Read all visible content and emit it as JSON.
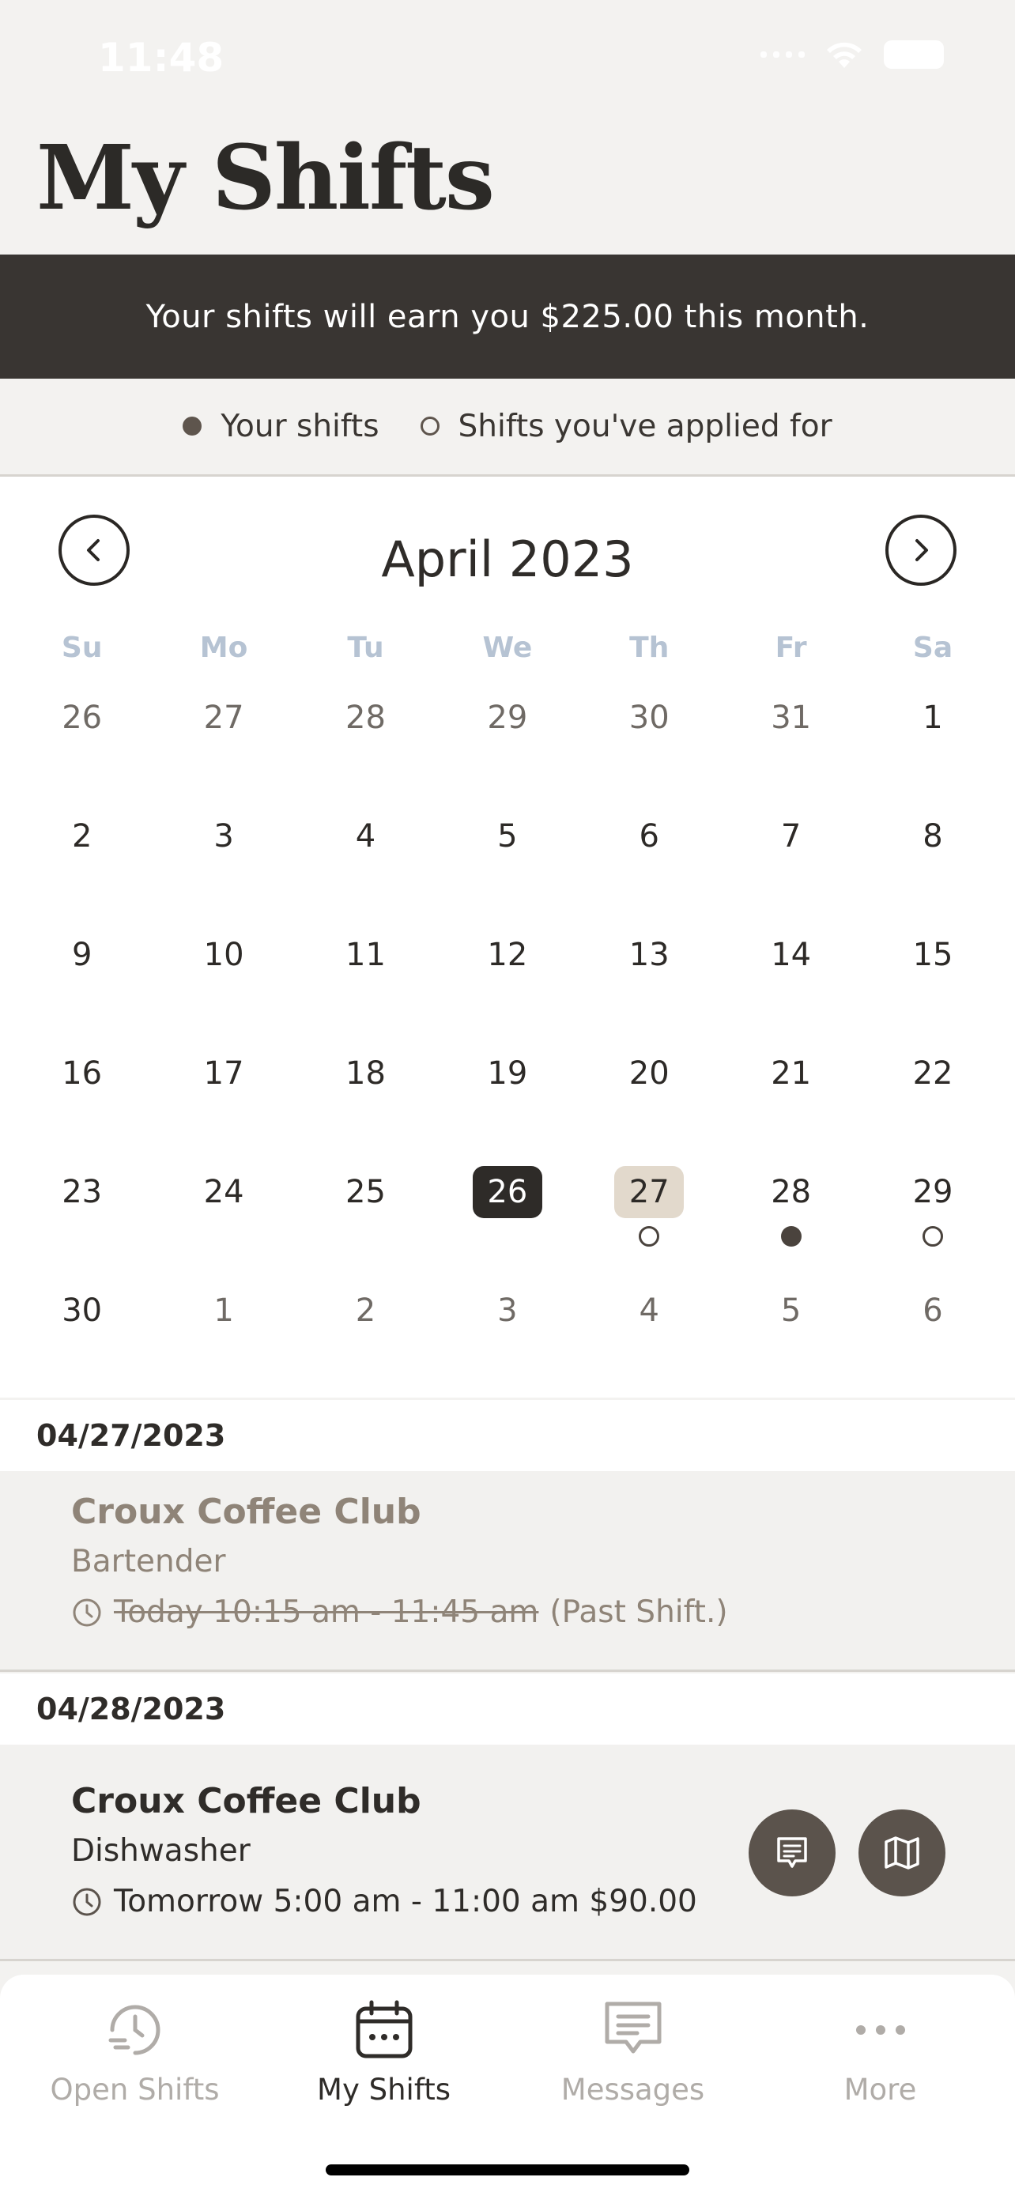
{
  "status_bar": {
    "time": "11:48"
  },
  "page": {
    "title": "My Shifts"
  },
  "banner": {
    "text": "Your shifts will earn you $225.00 this month."
  },
  "legend": {
    "your_shifts": "Your shifts",
    "applied": "Shifts you've applied for"
  },
  "calendar": {
    "month_label": "April 2023",
    "weekdays": [
      "Su",
      "Mo",
      "Tu",
      "We",
      "Th",
      "Fr",
      "Sa"
    ],
    "weeks": [
      [
        {
          "d": "26",
          "muted": true
        },
        {
          "d": "27",
          "muted": true
        },
        {
          "d": "28",
          "muted": true
        },
        {
          "d": "29",
          "muted": true
        },
        {
          "d": "30",
          "muted": true
        },
        {
          "d": "31",
          "muted": true
        },
        {
          "d": "1"
        }
      ],
      [
        {
          "d": "2"
        },
        {
          "d": "3"
        },
        {
          "d": "4"
        },
        {
          "d": "5"
        },
        {
          "d": "6"
        },
        {
          "d": "7"
        },
        {
          "d": "8"
        }
      ],
      [
        {
          "d": "9"
        },
        {
          "d": "10"
        },
        {
          "d": "11"
        },
        {
          "d": "12"
        },
        {
          "d": "13"
        },
        {
          "d": "14"
        },
        {
          "d": "15"
        }
      ],
      [
        {
          "d": "16"
        },
        {
          "d": "17"
        },
        {
          "d": "18"
        },
        {
          "d": "19"
        },
        {
          "d": "20"
        },
        {
          "d": "21"
        },
        {
          "d": "22"
        }
      ],
      [
        {
          "d": "23"
        },
        {
          "d": "24"
        },
        {
          "d": "25"
        },
        {
          "d": "26",
          "state": "today"
        },
        {
          "d": "27",
          "state": "selected",
          "marker": "applied"
        },
        {
          "d": "28",
          "marker": "shift"
        },
        {
          "d": "29",
          "marker": "applied"
        }
      ],
      [
        {
          "d": "30"
        },
        {
          "d": "1",
          "muted": true
        },
        {
          "d": "2",
          "muted": true
        },
        {
          "d": "3",
          "muted": true
        },
        {
          "d": "4",
          "muted": true
        },
        {
          "d": "5",
          "muted": true
        },
        {
          "d": "6",
          "muted": true
        }
      ]
    ]
  },
  "shifts": [
    {
      "date": "04/27/2023",
      "venue": "Croux Coffee Club",
      "role": "Bartender",
      "time": "Today 10:15 am - 11:45 am",
      "note": "(Past Shift.)"
    },
    {
      "date": "04/28/2023",
      "venue": "Croux Coffee Club",
      "role": "Dishwasher",
      "time": "Tomorrow 5:00 am - 11:00 am $90.00"
    }
  ],
  "tabs": [
    {
      "label": "Open Shifts",
      "icon": "clock-list-icon"
    },
    {
      "label": "My Shifts",
      "icon": "calendar-icon",
      "active": true
    },
    {
      "label": "Messages",
      "icon": "message-icon"
    },
    {
      "label": "More",
      "icon": "more-dots-icon"
    }
  ],
  "colors": {
    "banner_bg": "#393532",
    "today_bg": "#2e2b28",
    "selected_bg": "#e2d9cc",
    "weekday_text": "#b6c3d3",
    "action_btn": "#5b534c"
  }
}
